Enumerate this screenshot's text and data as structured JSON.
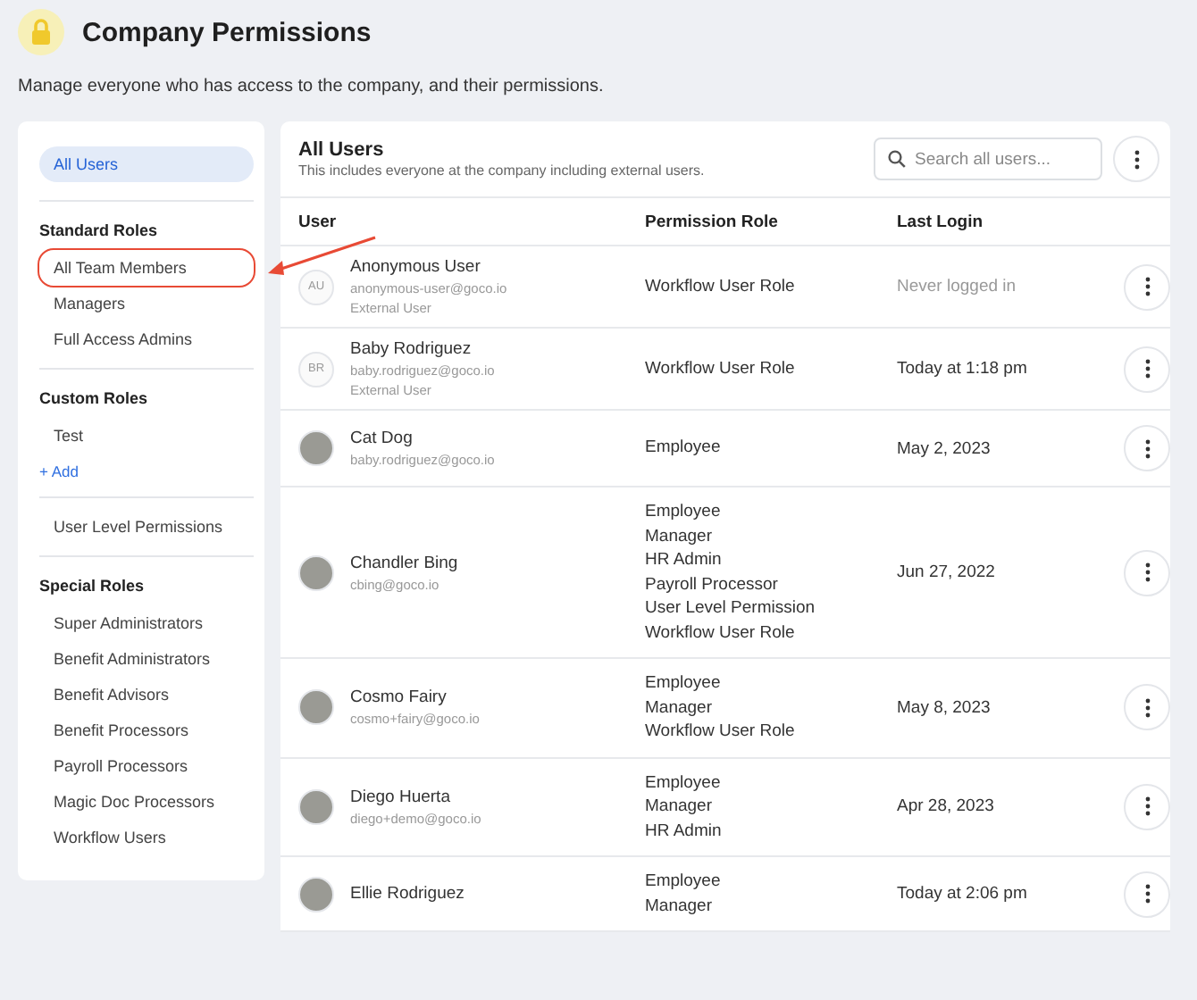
{
  "page": {
    "title": "Company Permissions",
    "description": "Manage everyone who has access to the company, and their permissions."
  },
  "sidebar": {
    "sections": [
      {
        "items": [
          {
            "label": "All Users",
            "selected": true,
            "annotated": false
          }
        ]
      },
      {
        "heading": "Standard Roles",
        "items": [
          {
            "label": "All Team Members",
            "selected": false,
            "annotated": true
          },
          {
            "label": "Managers",
            "selected": false,
            "annotated": false
          },
          {
            "label": "Full Access Admins",
            "selected": false,
            "annotated": false
          }
        ]
      },
      {
        "heading": "Custom Roles",
        "items": [
          {
            "label": "Test",
            "selected": false,
            "annotated": false
          }
        ],
        "add_link": "+ Add"
      },
      {
        "items": [
          {
            "label": "User Level Permissions",
            "selected": false,
            "annotated": false
          }
        ]
      },
      {
        "heading": "Special Roles",
        "items": [
          {
            "label": "Super Administrators",
            "selected": false,
            "annotated": false
          },
          {
            "label": "Benefit Administrators",
            "selected": false,
            "annotated": false
          },
          {
            "label": "Benefit Advisors",
            "selected": false,
            "annotated": false
          },
          {
            "label": "Benefit Processors",
            "selected": false,
            "annotated": false
          },
          {
            "label": "Payroll Processors",
            "selected": false,
            "annotated": false
          },
          {
            "label": "Magic Doc Processors",
            "selected": false,
            "annotated": false
          },
          {
            "label": "Workflow Users",
            "selected": false,
            "annotated": false
          }
        ]
      }
    ]
  },
  "table": {
    "title": "All Users",
    "subtitle": "This includes everyone at the company including external users.",
    "search": {
      "placeholder": "Search all users..."
    },
    "columns": [
      "User",
      "Permission Role",
      "Last Login"
    ],
    "rows": [
      {
        "avatar": {
          "kind": "initials",
          "text": "AU"
        },
        "name": "Anonymous User",
        "email": "anonymous-user@goco.io",
        "note": "External User",
        "roles": [
          "Workflow User Role"
        ],
        "last_login": "Never logged in",
        "never": true
      },
      {
        "avatar": {
          "kind": "initials",
          "text": "BR"
        },
        "name": "Baby Rodriguez",
        "email": "baby.rodriguez@goco.io",
        "note": "External User",
        "roles": [
          "Workflow User Role"
        ],
        "last_login": "Today at 1:18 pm",
        "never": false
      },
      {
        "avatar": {
          "kind": "photo"
        },
        "name": "Cat Dog",
        "email": "baby.rodriguez@goco.io",
        "roles": [
          "Employee"
        ],
        "last_login": "May 2, 2023",
        "never": false
      },
      {
        "avatar": {
          "kind": "photo"
        },
        "name": "Chandler Bing",
        "email": "cbing@goco.io",
        "roles": [
          "Employee",
          "Manager",
          "HR Admin",
          "Payroll Processor",
          "User Level Permission",
          "Workflow User Role"
        ],
        "last_login": "Jun 27, 2022",
        "never": false
      },
      {
        "avatar": {
          "kind": "photo"
        },
        "name": "Cosmo Fairy",
        "email": "cosmo+fairy@goco.io",
        "roles": [
          "Employee",
          "Manager",
          "Workflow User Role"
        ],
        "last_login": "May 8, 2023",
        "never": false
      },
      {
        "avatar": {
          "kind": "photo"
        },
        "name": "Diego Huerta",
        "email": "diego+demo@goco.io",
        "roles": [
          "Employee",
          "Manager",
          "HR Admin"
        ],
        "last_login": "Apr 28, 2023",
        "never": false
      },
      {
        "avatar": {
          "kind": "photo"
        },
        "name": "Ellie Rodriguez",
        "roles": [
          "Employee",
          "Manager"
        ],
        "last_login": "Today at 2:06 pm",
        "never": false
      }
    ]
  }
}
